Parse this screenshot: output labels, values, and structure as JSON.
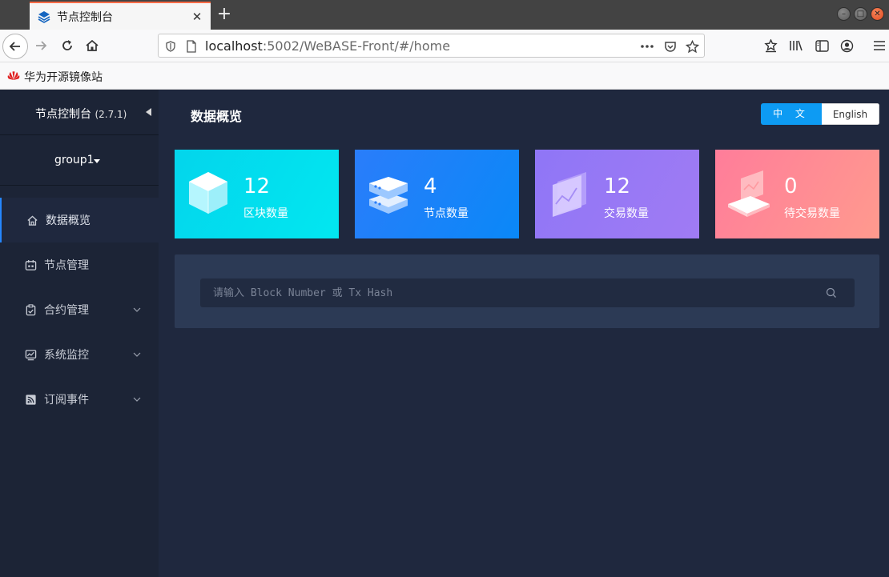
{
  "browser": {
    "tab_title": "节点控制台",
    "url_host": "localhost",
    "url_rest": ":5002/WeBASE-Front/#/home",
    "bookmark_label": "华为开源镜像站"
  },
  "sidebar": {
    "title": "节点控制台",
    "version": "(2.7.1)",
    "group": "group1",
    "items": [
      {
        "label": "数据概览",
        "icon": "home-icon",
        "active": true
      },
      {
        "label": "节点管理",
        "icon": "node-icon"
      },
      {
        "label": "合约管理",
        "icon": "contract-icon",
        "expandable": true
      },
      {
        "label": "系统监控",
        "icon": "monitor-icon",
        "expandable": true
      },
      {
        "label": "订阅事件",
        "icon": "rss-icon",
        "expandable": true
      }
    ]
  },
  "header": {
    "title": "数据概览",
    "lang_zh": "中 文",
    "lang_en": "English"
  },
  "cards": [
    {
      "value": "12",
      "label": "区块数量",
      "icon": "cube-icon",
      "color": "#03d5ec"
    },
    {
      "value": "4",
      "label": "节点数量",
      "icon": "server-stack-icon",
      "color": "#1a82f9"
    },
    {
      "value": "12",
      "label": "交易数量",
      "icon": "chart-panel-icon",
      "color": "#9878f5"
    },
    {
      "value": "0",
      "label": "待交易数量",
      "icon": "laptop-chart-icon",
      "color": "#ff8c94"
    }
  ],
  "search": {
    "placeholder": "请输入 Block Number 或 Tx Hash"
  }
}
